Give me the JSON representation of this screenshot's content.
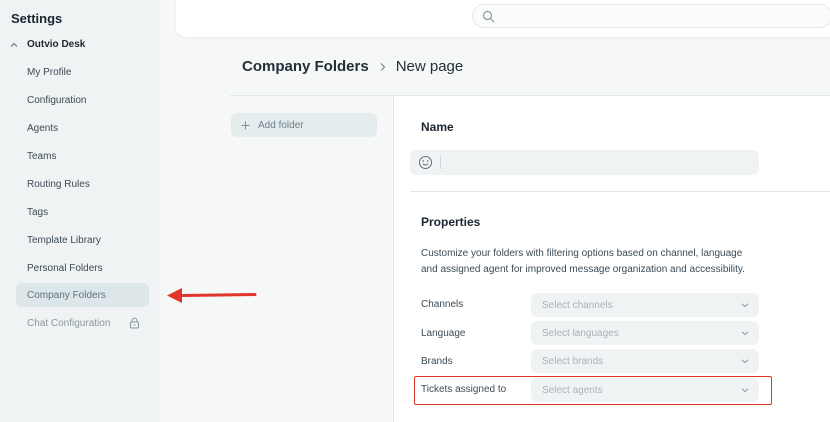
{
  "sidebar": {
    "title": "Settings",
    "group": "Outvio Desk",
    "items": [
      {
        "label": "My Profile"
      },
      {
        "label": "Configuration"
      },
      {
        "label": "Agents"
      },
      {
        "label": "Teams"
      },
      {
        "label": "Routing Rules"
      },
      {
        "label": "Tags"
      },
      {
        "label": "Template Library"
      },
      {
        "label": "Personal Folders"
      },
      {
        "label": "Company Folders"
      },
      {
        "label": "Chat Configuration"
      }
    ],
    "active_item": "Company Folders",
    "locked_item_icon": "lock-icon"
  },
  "search": {
    "placeholder": "",
    "icon": "search-icon"
  },
  "breadcrumb": {
    "root": "Company Folders",
    "current": "New page"
  },
  "folders": {
    "add_label": "Add folder"
  },
  "form": {
    "name_title": "Name",
    "name_value": "",
    "properties_title": "Properties",
    "description": "Customize your folders with filtering options based on channel, language and assigned agent for improved message organization and accessibility.",
    "fields": [
      {
        "label": "Channels",
        "placeholder": "Select channels"
      },
      {
        "label": "Language",
        "placeholder": "Select languages"
      },
      {
        "label": "Brands",
        "placeholder": "Select brands"
      },
      {
        "label": "Tickets assigned to",
        "placeholder": "Select agents"
      }
    ]
  },
  "colors": {
    "accent_highlight": "#e0352b",
    "active_nav_bg": "#dde6e8",
    "sidebar_bg": "#f0f3f3"
  }
}
